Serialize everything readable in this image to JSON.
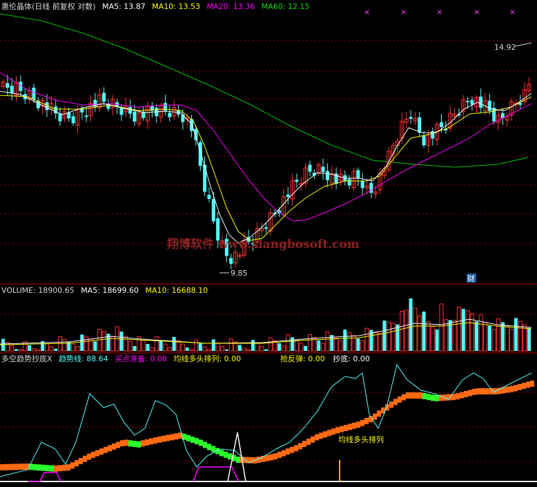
{
  "colors": {
    "up": "#ff3333",
    "down": "#54ffff",
    "grid": "#b00000",
    "sep": "#c00000",
    "ma5": "#ffffff",
    "ma10": "#ffff00",
    "ma20": "#ff00ff",
    "ma60": "#00c800",
    "text": "#d8d8d8",
    "trend": "#54ffff",
    "buyprep": "#ff00ff",
    "bull": "#ffff00",
    "bounce": "#ffff00",
    "bottom": "#ffffff",
    "band_up": "#ff6a13",
    "band_down": "#2cff2c",
    "watermark": "#8a2222"
  },
  "price_header": {
    "title": "惠伦晶体(日线 前复权 对数)",
    "ma5": "MA5: 13.87",
    "ma10": "MA10: 13.53",
    "ma20": "MA20: 13.36",
    "ma60": "MA60: 12.15"
  },
  "volume_header": {
    "vol": "VOLUME: 18900.65",
    "ma5": "MA5: 18699.60",
    "ma10": "MA10: 16688.10"
  },
  "indicator_header": {
    "name": "多空趋势抄底X",
    "trend": "趋势线: 88.64",
    "buyprep": "买点准备: 0.00",
    "bull": "均线多头排列: 0.00",
    "bounce": "抢反弹: 0.00",
    "bottom": "抄底: 0.00"
  },
  "annotations": {
    "high_label": "14.92",
    "low_label": "9.85",
    "cai": "财",
    "watermark": "翔博软件 www.xiangbosoft.com",
    "bull_label": "均线多头排列"
  },
  "chart_data": [
    {
      "type": "candlestick",
      "title": "惠伦晶体(日线 前复权 对数)",
      "ylim": [
        9.6,
        15.7
      ],
      "high": 14.92,
      "low": 9.85,
      "ma_values": {
        "MA5": 13.87,
        "MA10": 13.53,
        "MA20": 13.36,
        "MA60": 12.15
      }
    },
    {
      "type": "bar",
      "title": "VOLUME",
      "values": {
        "VOLUME": 18900.65,
        "MA5": 18699.6,
        "MA10": 16688.1
      }
    },
    {
      "type": "line",
      "title": "多空趋势抄底X",
      "values": {
        "趋势线": 88.64,
        "买点准备": 0.0,
        "均线多头排列": 0.0,
        "抢反弹": 0.0,
        "抄底": 0.0
      }
    }
  ]
}
